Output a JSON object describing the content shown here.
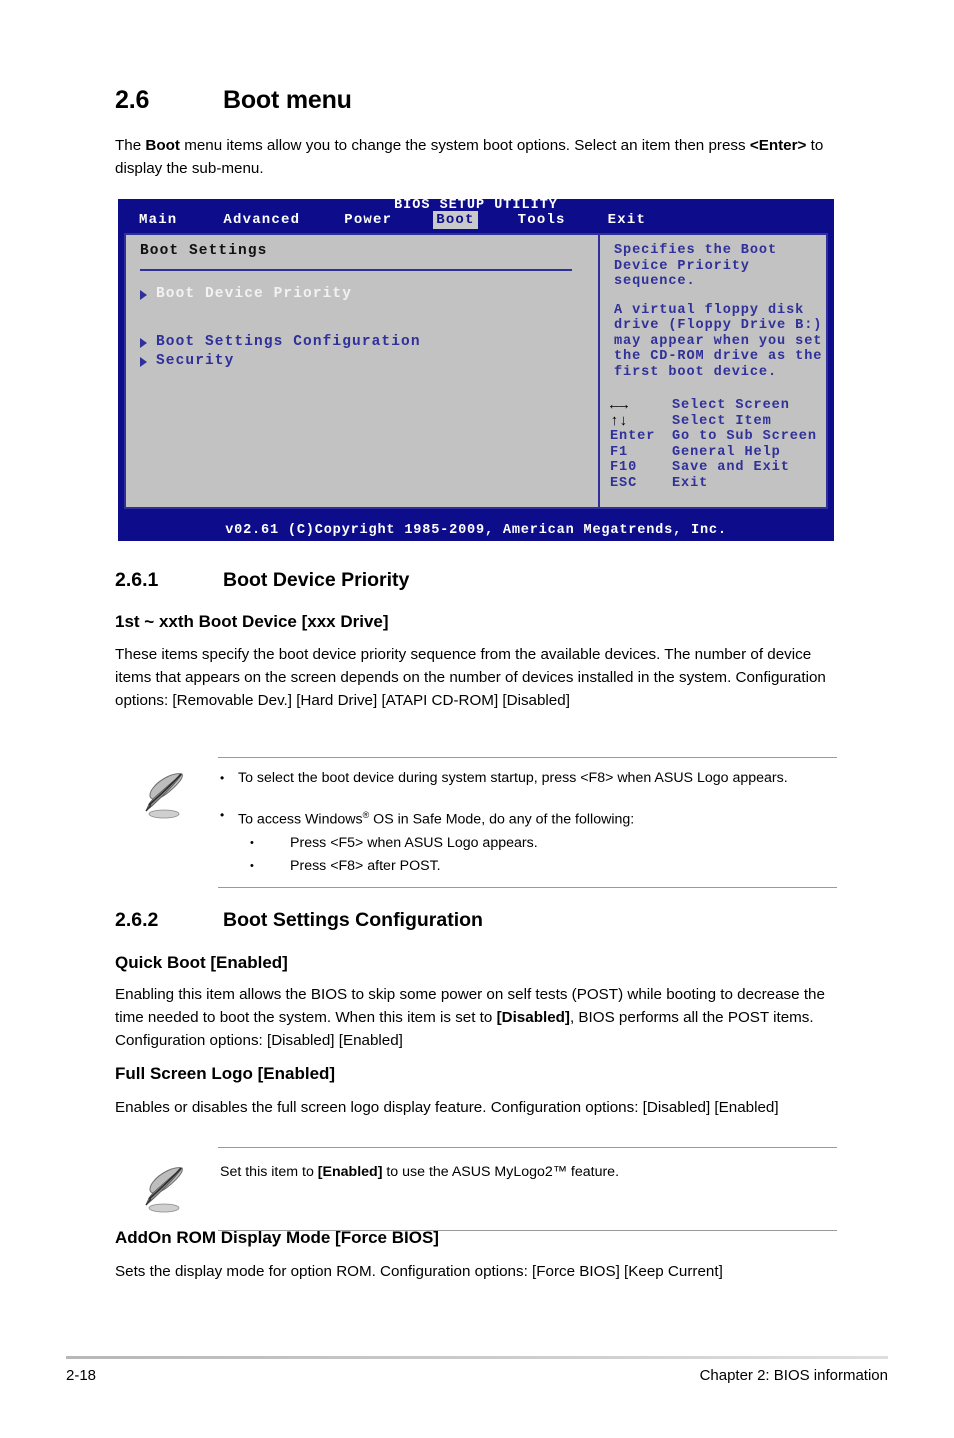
{
  "document": {
    "section_number": "2.6",
    "section_title": "Boot menu",
    "intro_1": "The ",
    "intro_bold_1": "Boot",
    "intro_2": " menu items allow you to change the system boot options. Select an item then press ",
    "intro_bold_2": "<Enter>",
    "intro_3": " to display the sub-menu."
  },
  "bios": {
    "title": "BIOS SETUP UTILITY",
    "menu": [
      {
        "label": "Main",
        "selected": false
      },
      {
        "label": "Advanced",
        "selected": false
      },
      {
        "label": "Power",
        "selected": false
      },
      {
        "label": "Boot",
        "selected": true
      },
      {
        "label": "Tools",
        "selected": false
      },
      {
        "label": "Exit",
        "selected": false
      }
    ],
    "panel_heading": "Boot Settings",
    "items": [
      {
        "label": "Boot Device Priority",
        "highlighted": true
      },
      {
        "label": "Boot Settings Configuration",
        "highlighted": false
      },
      {
        "label": "Security",
        "highlighted": false
      }
    ],
    "help_paragraphs": [
      "Specifies the Boot\nDevice Priority\nsequence.",
      "A virtual floppy disk\ndrive (Floppy Drive B:)\nmay appear when you set\nthe CD-ROM drive as the\nfirst boot device."
    ],
    "nav_keys": [
      {
        "key": "←→",
        "action": "Select Screen",
        "is_arrow": true
      },
      {
        "key": "↑↓",
        "action": "Select Item",
        "is_arrow": true
      },
      {
        "key": "Enter",
        "action": "Go to Sub Screen",
        "is_arrow": false
      },
      {
        "key": "F1",
        "action": "General Help",
        "is_arrow": false
      },
      {
        "key": "F10",
        "action": "Save and Exit",
        "is_arrow": false
      },
      {
        "key": "ESC",
        "action": "Exit",
        "is_arrow": false
      }
    ],
    "footer": "v02.61 (C)Copyright 1985-2009, American Megatrends, Inc.",
    "colors": {
      "header_blue": "#0d0d8c",
      "panel_gray": "#c2c2c2",
      "text_blue": "#30309a",
      "highlight_text": "#f2f2f2"
    }
  },
  "sections": {
    "s261": {
      "number": "2.6.1",
      "title": "Boot Device Priority",
      "item_heading": "1st ~ xxth Boot Device [xxx Drive]",
      "body": "These items specify the boot device priority sequence from the available devices. The number of device items that appears on the screen depends on the number of devices installed in the system. Configuration options: [Removable Dev.] [Hard Drive] [ATAPI CD-ROM] [Disabled]"
    },
    "note1": {
      "bullet1": "To select the boot device during system startup, press <F8> when ASUS Logo appears.",
      "bullet2_pre": "To access Windows",
      "bullet2_sup": "®",
      "bullet2_post": " OS in Safe Mode, do any of the following:",
      "sub1": "Press <F5> when ASUS Logo appears.",
      "sub2": "Press <F8> after POST.",
      "bullet_glyph": "•"
    },
    "s262": {
      "number": "2.6.2",
      "title": "Boot Settings Configuration",
      "quick_boot_heading": "Quick Boot [Enabled]",
      "quick_boot_body_1": "Enabling this item allows the BIOS to skip some power on self tests (POST) while booting to decrease the time needed to boot the system. When this item is set to ",
      "quick_boot_body_bold": "[Disabled]",
      "quick_boot_body_2": ", BIOS performs all the POST items. Configuration options: [Disabled] [Enabled]",
      "full_screen_heading": "Full Screen Logo [Enabled]",
      "full_screen_body": "Enables or disables the full screen logo display feature. Configuration options: [Disabled] [Enabled]"
    },
    "note2": {
      "text_1": "Set this item to ",
      "text_bold": "[Enabled]",
      "text_2": " to use the ASUS MyLogo2™ feature."
    },
    "s263": {
      "addon_heading": "AddOn ROM Display Mode [Force BIOS]",
      "addon_body": "Sets the display mode for option ROM. Configuration options: [Force BIOS] [Keep Current]"
    }
  },
  "page_footer": {
    "page_number": "2-18",
    "chapter": "Chapter 2: BIOS information"
  }
}
